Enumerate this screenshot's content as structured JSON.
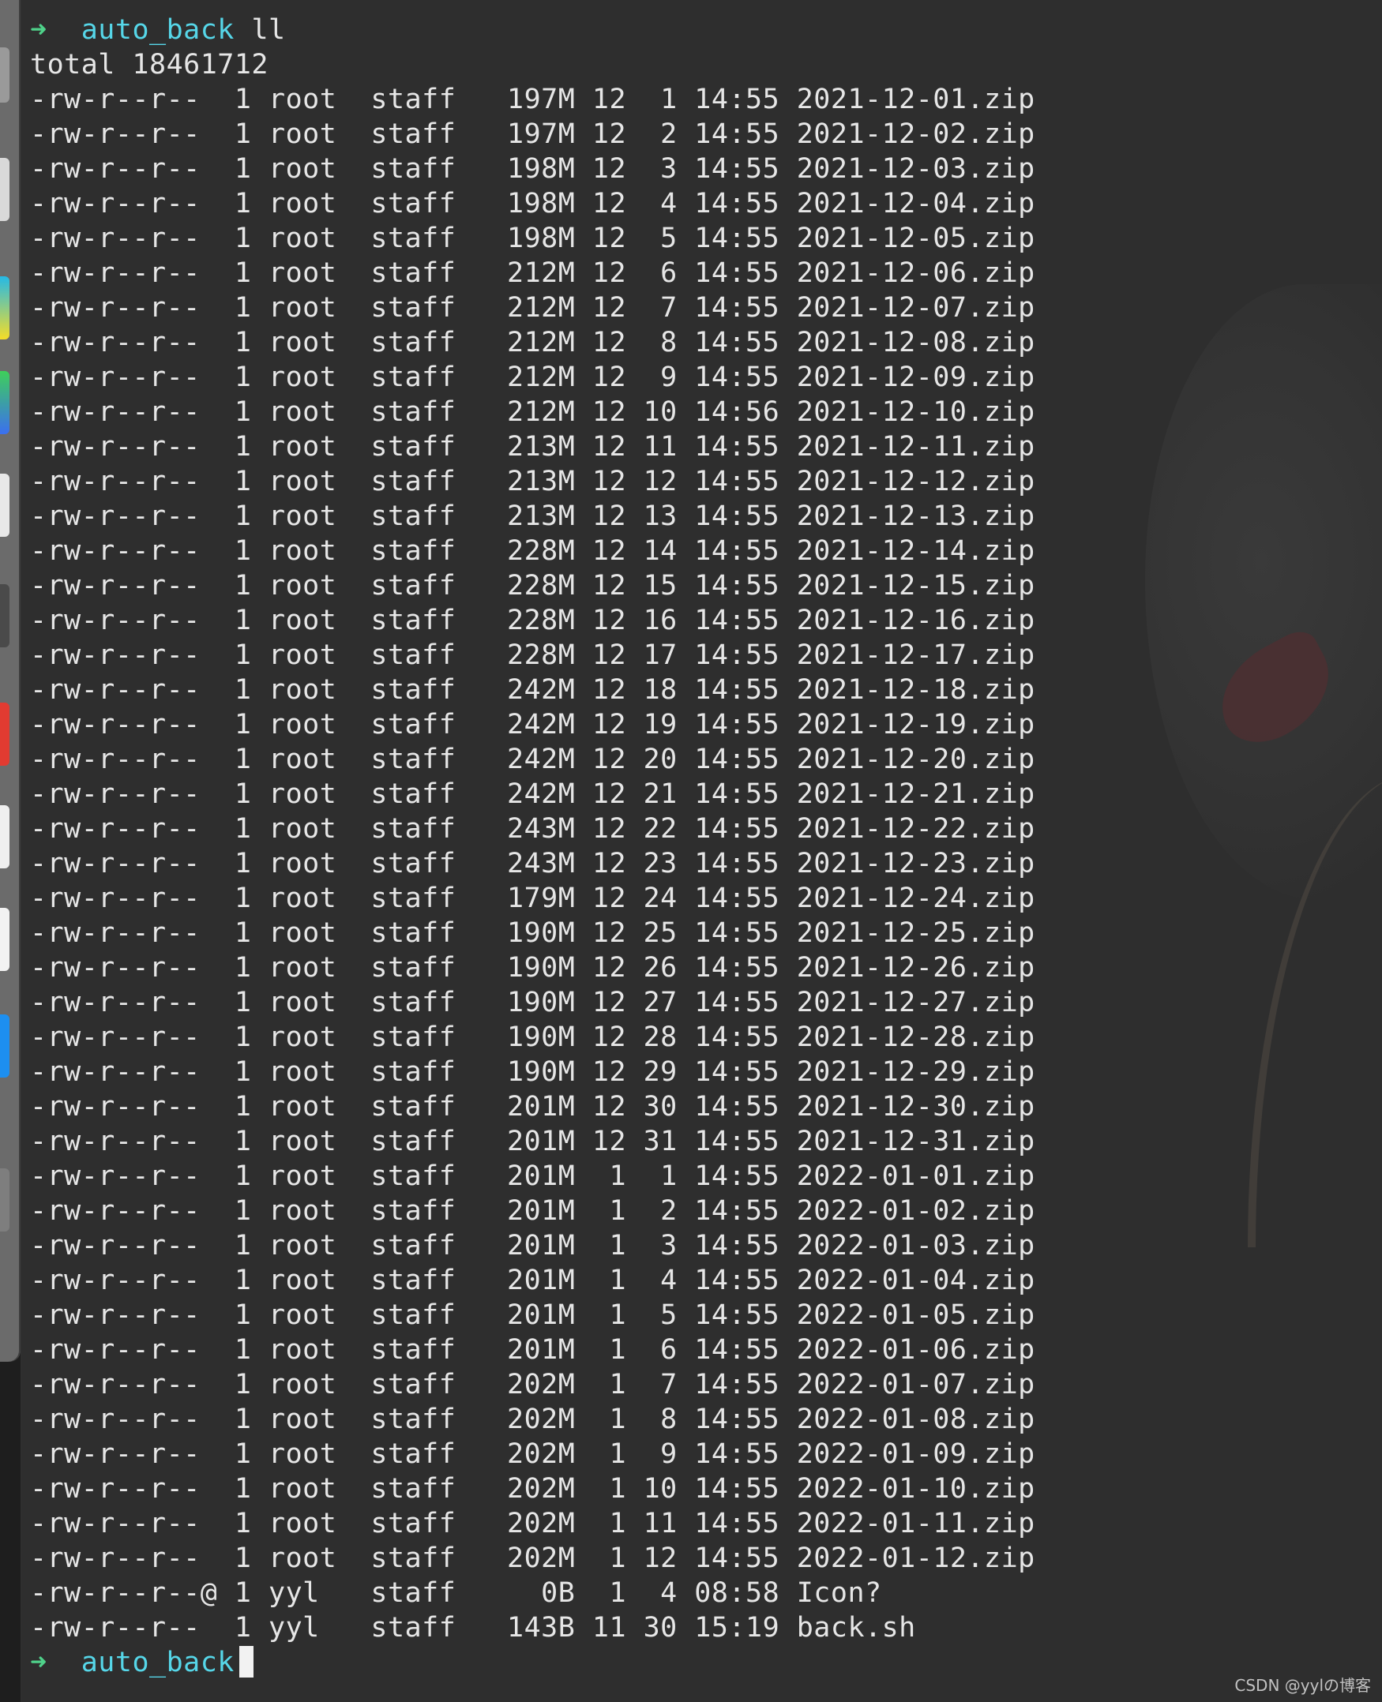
{
  "prompt": {
    "symbol": "➜",
    "cwd": "auto_back",
    "command": "ll"
  },
  "prompt_end": {
    "symbol": "➜",
    "cwd": "auto_back"
  },
  "total_line": "total 18461712",
  "listing": [
    "-rw-r--r--  1 root  staff   197M 12  1 14:55 2021-12-01.zip",
    "-rw-r--r--  1 root  staff   197M 12  2 14:55 2021-12-02.zip",
    "-rw-r--r--  1 root  staff   198M 12  3 14:55 2021-12-03.zip",
    "-rw-r--r--  1 root  staff   198M 12  4 14:55 2021-12-04.zip",
    "-rw-r--r--  1 root  staff   198M 12  5 14:55 2021-12-05.zip",
    "-rw-r--r--  1 root  staff   212M 12  6 14:55 2021-12-06.zip",
    "-rw-r--r--  1 root  staff   212M 12  7 14:55 2021-12-07.zip",
    "-rw-r--r--  1 root  staff   212M 12  8 14:55 2021-12-08.zip",
    "-rw-r--r--  1 root  staff   212M 12  9 14:55 2021-12-09.zip",
    "-rw-r--r--  1 root  staff   212M 12 10 14:56 2021-12-10.zip",
    "-rw-r--r--  1 root  staff   213M 12 11 14:55 2021-12-11.zip",
    "-rw-r--r--  1 root  staff   213M 12 12 14:55 2021-12-12.zip",
    "-rw-r--r--  1 root  staff   213M 12 13 14:55 2021-12-13.zip",
    "-rw-r--r--  1 root  staff   228M 12 14 14:55 2021-12-14.zip",
    "-rw-r--r--  1 root  staff   228M 12 15 14:55 2021-12-15.zip",
    "-rw-r--r--  1 root  staff   228M 12 16 14:55 2021-12-16.zip",
    "-rw-r--r--  1 root  staff   228M 12 17 14:55 2021-12-17.zip",
    "-rw-r--r--  1 root  staff   242M 12 18 14:55 2021-12-18.zip",
    "-rw-r--r--  1 root  staff   242M 12 19 14:55 2021-12-19.zip",
    "-rw-r--r--  1 root  staff   242M 12 20 14:55 2021-12-20.zip",
    "-rw-r--r--  1 root  staff   242M 12 21 14:55 2021-12-21.zip",
    "-rw-r--r--  1 root  staff   243M 12 22 14:55 2021-12-22.zip",
    "-rw-r--r--  1 root  staff   243M 12 23 14:55 2021-12-23.zip",
    "-rw-r--r--  1 root  staff   179M 12 24 14:55 2021-12-24.zip",
    "-rw-r--r--  1 root  staff   190M 12 25 14:55 2021-12-25.zip",
    "-rw-r--r--  1 root  staff   190M 12 26 14:55 2021-12-26.zip",
    "-rw-r--r--  1 root  staff   190M 12 27 14:55 2021-12-27.zip",
    "-rw-r--r--  1 root  staff   190M 12 28 14:55 2021-12-28.zip",
    "-rw-r--r--  1 root  staff   190M 12 29 14:55 2021-12-29.zip",
    "-rw-r--r--  1 root  staff   201M 12 30 14:55 2021-12-30.zip",
    "-rw-r--r--  1 root  staff   201M 12 31 14:55 2021-12-31.zip",
    "-rw-r--r--  1 root  staff   201M  1  1 14:55 2022-01-01.zip",
    "-rw-r--r--  1 root  staff   201M  1  2 14:55 2022-01-02.zip",
    "-rw-r--r--  1 root  staff   201M  1  3 14:55 2022-01-03.zip",
    "-rw-r--r--  1 root  staff   201M  1  4 14:55 2022-01-04.zip",
    "-rw-r--r--  1 root  staff   201M  1  5 14:55 2022-01-05.zip",
    "-rw-r--r--  1 root  staff   201M  1  6 14:55 2022-01-06.zip",
    "-rw-r--r--  1 root  staff   202M  1  7 14:55 2022-01-07.zip",
    "-rw-r--r--  1 root  staff   202M  1  8 14:55 2022-01-08.zip",
    "-rw-r--r--  1 root  staff   202M  1  9 14:55 2022-01-09.zip",
    "-rw-r--r--  1 root  staff   202M  1 10 14:55 2022-01-10.zip",
    "-rw-r--r--  1 root  staff   202M  1 11 14:55 2022-01-11.zip",
    "-rw-r--r--  1 root  staff   202M  1 12 14:55 2022-01-12.zip",
    "-rw-r--r--@ 1 yyl   staff     0B  1  4 08:58 Icon?",
    "-rw-r--r--  1 yyl   staff   143B 11 30 15:19 back.sh"
  ],
  "watermark": "CSDN @yylの博客",
  "colors": {
    "background": "#2e2e2e",
    "text": "#e6e6e6",
    "prompt_arrow": "#4fd28a",
    "prompt_dir": "#56d6e8"
  },
  "icons": [
    "prompt-arrow-icon",
    "cursor-block"
  ]
}
